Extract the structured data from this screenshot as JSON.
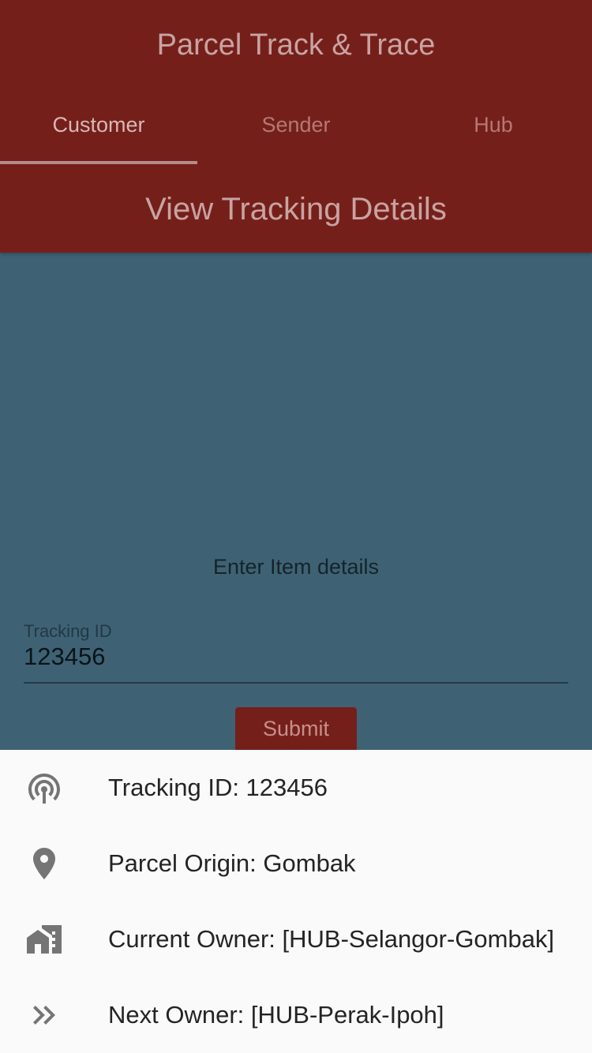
{
  "app_title": "Parcel Track & Trace",
  "tabs": [
    {
      "label": "Customer",
      "active": true
    },
    {
      "label": "Sender",
      "active": false
    },
    {
      "label": "Hub",
      "active": false
    }
  ],
  "subheader": "View Tracking Details",
  "form": {
    "prompt": "Enter Item details",
    "tracking_label": "Tracking ID",
    "tracking_value": "123456",
    "submit_label": "Submit"
  },
  "details": [
    {
      "icon": "tracking-signal-icon",
      "text": "Tracking ID:  123456"
    },
    {
      "icon": "location-pin-icon",
      "text": "Parcel Origin:  Gombak"
    },
    {
      "icon": "home-work-icon",
      "text": "Current Owner:  [HUB-Selangor-Gombak]"
    },
    {
      "icon": "double-chevron-right-icon",
      "text": "Next Owner:  [HUB-Perak-Ipoh]"
    }
  ],
  "colors": {
    "primary": "#751f1b",
    "background": "#3e6274",
    "sheet": "#fafafa"
  }
}
